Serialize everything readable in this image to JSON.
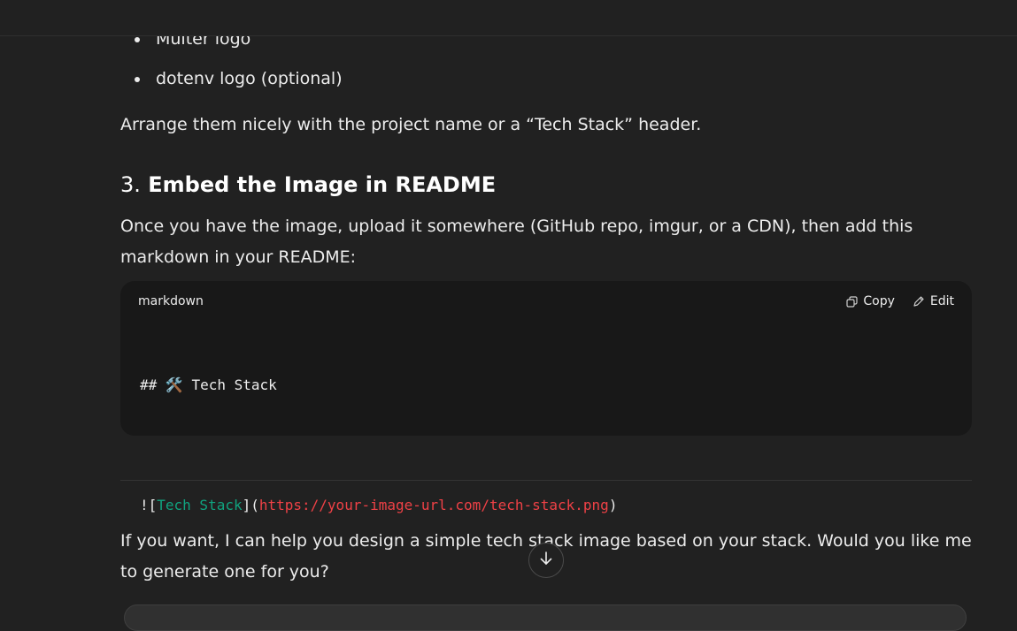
{
  "bullets": [
    "Multer logo",
    "dotenv logo (optional)"
  ],
  "para_arrange": "Arrange them nicely with the project name or a “Tech Stack” header.",
  "heading": {
    "number": "3.",
    "text": "Embed the Image in README"
  },
  "para_embed": "Once you have the image, upload it somewhere (GitHub repo, imgur, or a CDN), then add this markdown in your README:",
  "code": {
    "language": "markdown",
    "copy_label": "Copy",
    "edit_label": "Edit",
    "line1": "## 🛠️ Tech Stack",
    "line2_prefix": "![",
    "line2_alt": "Tech Stack",
    "line2_mid": "](",
    "line2_url": "https://your-image-url.com/tech-stack.png",
    "line2_suffix": ")"
  },
  "para_offer": "If you want, I can help you design a simple tech stack image based on your stack. Would you like me to generate one for you?",
  "icons": {
    "copy": "copy-icon",
    "edit": "edit-icon",
    "scroll": "arrow-down-icon"
  },
  "colors": {
    "background": "#212121",
    "code_background": "#181818",
    "link_text": "#10a37f",
    "url": "#ef4146"
  }
}
